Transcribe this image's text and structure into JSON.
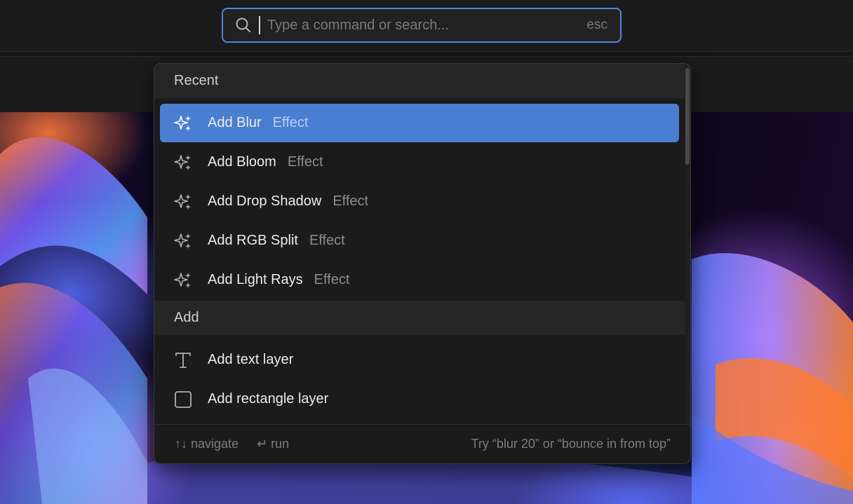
{
  "search": {
    "placeholder": "Type a command or search...",
    "value": "",
    "esc_label": "esc"
  },
  "palette": {
    "sections": [
      {
        "title": "Recent",
        "items": [
          {
            "label": "Add Blur",
            "category": "Effect",
            "icon": "sparkle-icon",
            "active": true
          },
          {
            "label": "Add Bloom",
            "category": "Effect",
            "icon": "sparkle-icon"
          },
          {
            "label": "Add Drop Shadow",
            "category": "Effect",
            "icon": "sparkle-icon"
          },
          {
            "label": "Add RGB Split",
            "category": "Effect",
            "icon": "sparkle-icon"
          },
          {
            "label": "Add Light Rays",
            "category": "Effect",
            "icon": "sparkle-icon"
          }
        ]
      },
      {
        "title": "Add",
        "items": [
          {
            "label": "Add text layer",
            "icon": "text-icon"
          },
          {
            "label": "Add rectangle layer",
            "icon": "rectangle-icon"
          }
        ]
      }
    ],
    "footer": {
      "navigate_hint": "↑↓ navigate",
      "run_hint": "↵ run",
      "tip": "Try “blur 20” or “bounce in from top”"
    }
  },
  "colors": {
    "accent": "#4a7ed0",
    "focus_border": "#4f86e0",
    "panel_bg": "#1b1b1b"
  }
}
